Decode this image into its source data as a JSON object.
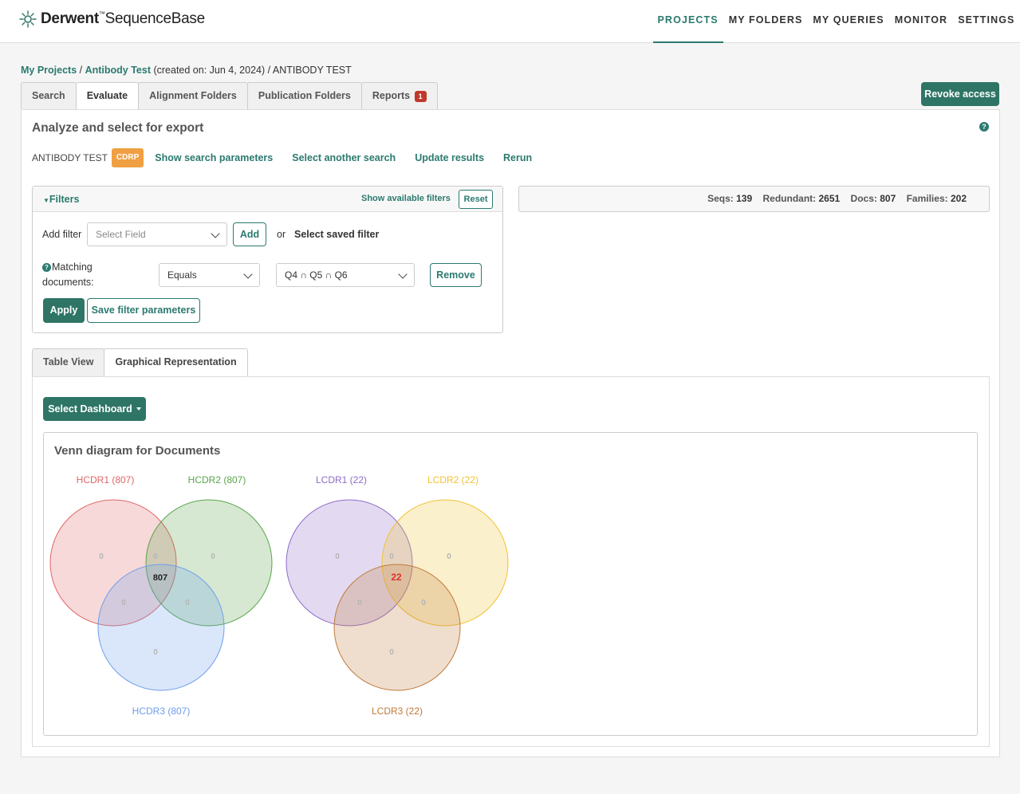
{
  "brand": {
    "name_bold": "Derwent",
    "tm": "™",
    "name_rest": "SequenceBase"
  },
  "nav": [
    {
      "label": "PROJECTS",
      "active": true
    },
    {
      "label": "MY FOLDERS",
      "active": false
    },
    {
      "label": "MY QUERIES",
      "active": false
    },
    {
      "label": "MONITOR",
      "active": false
    },
    {
      "label": "SETTINGS",
      "active": false
    }
  ],
  "breadcrumb": {
    "projects": "My Projects",
    "sep1": " / ",
    "project": "Antibody Test",
    "created": " (created on: Jun 4, 2024)",
    "sep2": " / ",
    "search": "ANTIBODY TEST"
  },
  "tabs": [
    {
      "label": "Search",
      "active": false
    },
    {
      "label": "Evaluate",
      "active": true
    },
    {
      "label": "Alignment Folders",
      "active": false
    },
    {
      "label": "Publication Folders",
      "active": false
    },
    {
      "label": "Reports",
      "active": false,
      "badge": "1"
    }
  ],
  "revoke_label": "Revoke access",
  "panel": {
    "title": "Analyze and select for export",
    "help": "?",
    "search_name": "ANTIBODY TEST",
    "search_tag": "CDRP",
    "links": [
      "Show search parameters",
      "Select another search",
      "Update results",
      "Rerun"
    ]
  },
  "filters": {
    "title": "Filters",
    "show_available": "Show available filters",
    "reset": "Reset",
    "add_filter_label": "Add filter",
    "field_placeholder": "Select Field",
    "add_label": "Add",
    "or_label": "or",
    "saved_filter_link": "Select saved filter",
    "matching_label_1": "Matching",
    "matching_label_2": "documents:",
    "operator": "Equals",
    "value": "Q4 ∩ Q5 ∩ Q6",
    "remove_label": "Remove",
    "apply_label": "Apply",
    "save_label": "Save filter parameters"
  },
  "stats": {
    "seqs_label": "Seqs:",
    "seqs": "139",
    "redundant_label": "Redundant:",
    "redundant": "2651",
    "docs_label": "Docs:",
    "docs": "807",
    "families_label": "Families:",
    "families": "202"
  },
  "view_tabs": [
    {
      "label": "Table View",
      "active": false
    },
    {
      "label": "Graphical Representation",
      "active": true
    }
  ],
  "dashboard_label": "Select Dashboard",
  "venn": {
    "title": "Venn diagram for Documents",
    "colors": {
      "hcdr1": "#e06666",
      "hcdr2": "#5aa54a",
      "hcdr3": "#6d9eeb",
      "lcdr1": "#8e6bc9",
      "lcdr2": "#f1c232",
      "lcdr3": "#c17a3a",
      "highlight": "#e03030"
    },
    "heavy": {
      "labels": [
        "HCDR1 (807)",
        "HCDR2 (807)",
        "HCDR3 (807)"
      ],
      "regions": {
        "a": "0",
        "b": "0",
        "c": "0",
        "ab": "0",
        "ac": "0",
        "bc": "0",
        "abc": "807"
      }
    },
    "light": {
      "labels": [
        "LCDR1 (22)",
        "LCDR2 (22)",
        "LCDR3 (22)"
      ],
      "regions": {
        "a": "0",
        "b": "0",
        "c": "0",
        "ab": "0",
        "ac": "0",
        "bc": "0",
        "abc": "22"
      }
    }
  }
}
